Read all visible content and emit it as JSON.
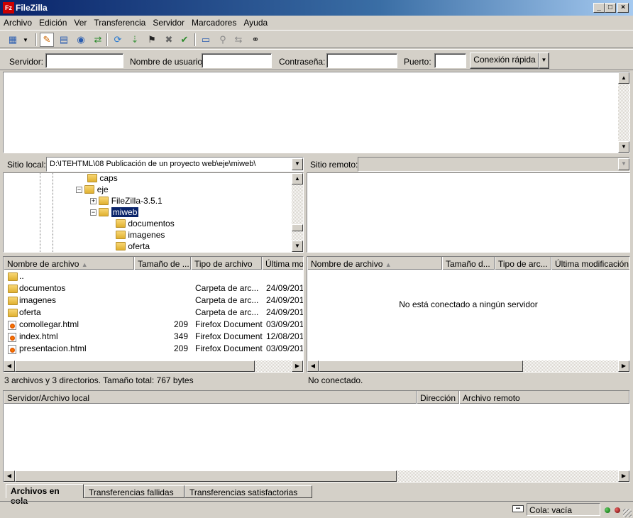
{
  "window": {
    "title": "FileZilla",
    "app_icon": "Fz"
  },
  "menu": [
    "Archivo",
    "Edición",
    "Ver",
    "Transferencia",
    "Servidor",
    "Marcadores",
    "Ayuda"
  ],
  "quickconnect": {
    "server_label": "Servidor:",
    "user_label": "Nombre de usuario:",
    "password_label": "Contraseña:",
    "port_label": "Puerto:",
    "button_label": "Conexión rápida",
    "server_value": "",
    "user_value": "",
    "password_value": "",
    "port_value": ""
  },
  "local": {
    "site_label": "Sitio local:",
    "path": "D:\\ITEHTML\\08 Publicación de un proyecto web\\eje\\miweb\\",
    "tree": [
      {
        "label": "caps"
      },
      {
        "label": "eje"
      },
      {
        "label": "FileZilla-3.5.1"
      },
      {
        "label": "miweb"
      },
      {
        "label": "documentos"
      },
      {
        "label": "imagenes"
      },
      {
        "label": "oferta"
      }
    ],
    "columns": [
      "Nombre de archivo",
      "Tamaño de ...",
      "Tipo de archivo",
      "Última mod"
    ],
    "files": [
      {
        "name": "..",
        "size": "",
        "type": "",
        "date": ""
      },
      {
        "name": "documentos",
        "size": "",
        "type": "Carpeta de arc...",
        "date": "24/09/201"
      },
      {
        "name": "imagenes",
        "size": "",
        "type": "Carpeta de arc...",
        "date": "24/09/201"
      },
      {
        "name": "oferta",
        "size": "",
        "type": "Carpeta de arc...",
        "date": "24/09/201"
      },
      {
        "name": "comollegar.html",
        "size": "209",
        "type": "Firefox Document",
        "date": "03/09/201"
      },
      {
        "name": "index.html",
        "size": "349",
        "type": "Firefox Document",
        "date": "12/08/201"
      },
      {
        "name": "presentacion.html",
        "size": "209",
        "type": "Firefox Document",
        "date": "03/09/201"
      }
    ],
    "status": "3 archivos y 3 directorios. Tamaño total: 767 bytes"
  },
  "remote": {
    "site_label": "Sitio remoto:",
    "path": "",
    "columns": [
      "Nombre de archivo",
      "Tamaño d...",
      "Tipo de arc...",
      "Última modificación"
    ],
    "empty_message": "No está conectado a ningún servidor",
    "status": "No conectado."
  },
  "queue": {
    "columns": [
      "Servidor/Archivo local",
      "Dirección",
      "Archivo remoto"
    ],
    "tabs": [
      "Archivos en cola",
      "Transferencias fallidas",
      "Transferencias satisfactorias"
    ]
  },
  "statusbar": {
    "queue_text": "Cola: vacía"
  },
  "colors": {
    "title_bg": "#0a246a",
    "selection": "#0a246a",
    "window_bg": "#d4d0c8"
  }
}
